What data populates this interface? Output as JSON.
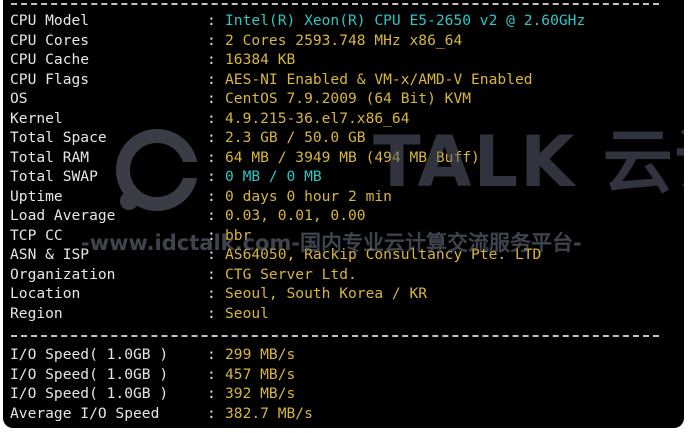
{
  "sysinfo": [
    {
      "label": "CPU Model",
      "value": "Intel(R) Xeon(R) CPU E5-2650 v2 @ 2.60GHz",
      "color": "#2fc6c4"
    },
    {
      "label": "CPU Cores",
      "value": "2 Cores 2593.748 MHz x86_64",
      "color": "#d8b63c"
    },
    {
      "label": "CPU Cache",
      "value": "16384 KB",
      "color": "#d8b63c"
    },
    {
      "label": "CPU Flags",
      "value": "AES-NI Enabled & VM-x/AMD-V Enabled",
      "color": "#d8b63c"
    },
    {
      "label": "OS",
      "value": "CentOS 7.9.2009 (64 Bit) KVM",
      "color": "#d8b63c"
    },
    {
      "label": "Kernel",
      "value": "4.9.215-36.el7.x86_64",
      "color": "#d8b63c"
    },
    {
      "label": "Total Space",
      "value": "2.3 GB / 50.0 GB",
      "color": "#d8b63c"
    },
    {
      "label": "Total RAM",
      "value": "64 MB / 3949 MB (494 MB Buff)",
      "color": "#d8b63c"
    },
    {
      "label": "Total SWAP",
      "value": "0 MB / 0 MB",
      "color": "#2fc6c4"
    },
    {
      "label": "Uptime",
      "value": "0 days 0 hour 2 min",
      "color": "#d8b63c"
    },
    {
      "label": "Load Average",
      "value": "0.03, 0.01, 0.00",
      "color": "#d8b63c"
    },
    {
      "label": "TCP CC",
      "value": "bbr",
      "color": "#d8b63c"
    },
    {
      "label": "ASN & ISP",
      "value": "AS64050, Rackip Consultancy Pte. LTD",
      "color": "#d8b63c"
    },
    {
      "label": "Organization",
      "value": "CTG Server Ltd.",
      "color": "#d8b63c"
    },
    {
      "label": "Location",
      "value": "Seoul, South Korea / KR",
      "color": "#d8b63c"
    },
    {
      "label": "Region",
      "value": "Seoul",
      "color": "#d8b63c"
    }
  ],
  "io": [
    {
      "label": "I/O Speed( 1.0GB )",
      "value": "299 MB/s",
      "color": "#d8b63c"
    },
    {
      "label": "I/O Speed( 1.0GB )",
      "value": "457 MB/s",
      "color": "#d8b63c"
    },
    {
      "label": "I/O Speed( 1.0GB )",
      "value": "392 MB/s",
      "color": "#d8b63c"
    },
    {
      "label": "Average I/O Speed",
      "value": "382.7 MB/s",
      "color": "#d8b63c"
    }
  ],
  "separator": ":",
  "watermark": {
    "brand": "TALK 云说",
    "url": "-www.idctalk.com-国内专业云计算交流服务平台-"
  }
}
